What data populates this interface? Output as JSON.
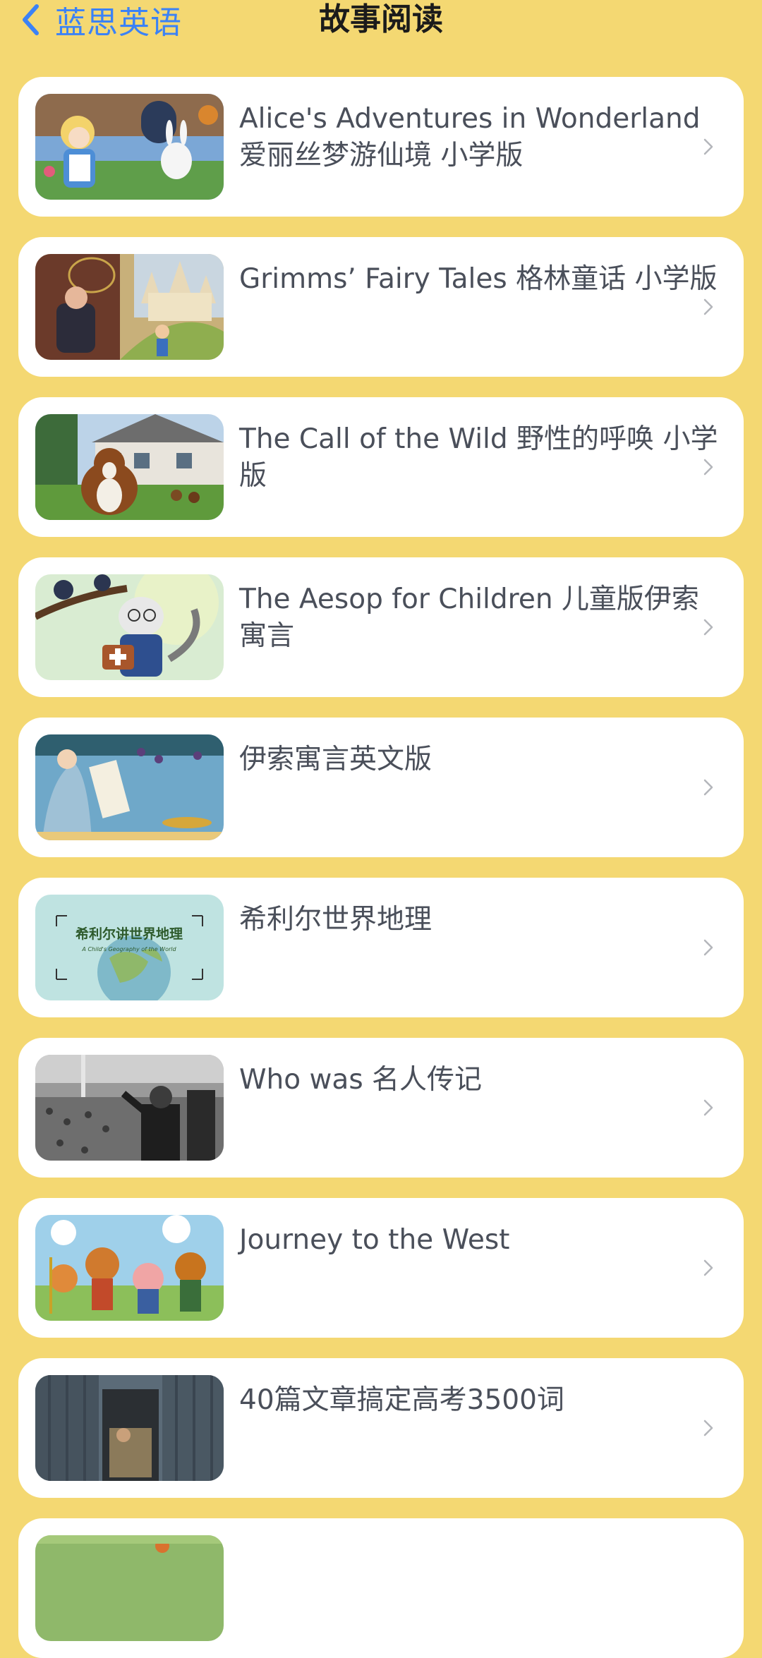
{
  "nav": {
    "back_label": "蓝思英语",
    "title": "故事阅读"
  },
  "colors": {
    "background": "#F4D872",
    "card": "#FFFFFF",
    "accent": "#3B82F6",
    "text": "#4A4F5A"
  },
  "icons": {
    "back": "chevron-left-icon",
    "row": "chevron-right-icon"
  },
  "books": [
    {
      "title": "Alice's Adventures in Wonderland 爱丽丝梦游仙境 小学版",
      "cover": "alice-wonderland-cover"
    },
    {
      "title": "Grimms’ Fairy Tales 格林童话 小学版",
      "cover": "grimms-fairy-tales-cover"
    },
    {
      "title": "The Call of the Wild 野性的呼唤 小学版",
      "cover": "call-of-the-wild-cover"
    },
    {
      "title": "The Aesop for Children 儿童版伊索寓言",
      "cover": "aesop-for-children-cover"
    },
    {
      "title": "伊索寓言英文版",
      "cover": "aesops-fables-cover"
    },
    {
      "title": "希利尔世界地理",
      "cover": "hillyer-geography-cover",
      "cover_text": "希利尔讲世界地理",
      "cover_subtext": "A Child's Geography of the World"
    },
    {
      "title": "Who was 名人传记",
      "cover": "who-was-biography-cover"
    },
    {
      "title": "Journey to the West",
      "cover": "journey-to-the-west-cover"
    },
    {
      "title": "40篇文章搞定高考3500词",
      "cover": "forty-articles-cover"
    },
    {
      "title": "",
      "cover": "partial-next-cover"
    }
  ]
}
